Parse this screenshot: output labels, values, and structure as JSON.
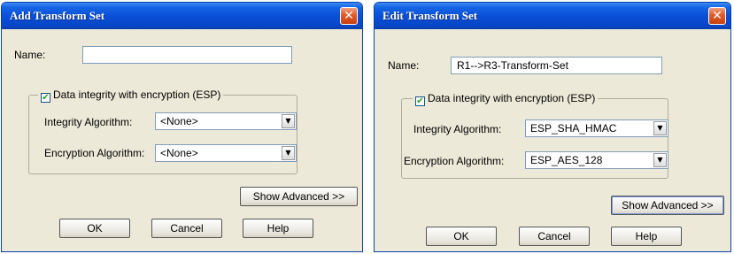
{
  "dialogs": [
    {
      "title": "Add Transform Set",
      "close_glyph": "✕",
      "name_label": "Name:",
      "name_value": "",
      "group_label": "Data integrity with encryption (ESP)",
      "group_checked": true,
      "check_glyph": "✔",
      "integrity_label": "Integrity Algorithm:",
      "integrity_value": "<None>",
      "encryption_label": "Encryption Algorithm:",
      "encryption_value": "<None>",
      "dropdown_glyph": "▼",
      "show_advanced_label": "Show Advanced >>",
      "ok_label": "OK",
      "cancel_label": "Cancel",
      "help_label": "Help"
    },
    {
      "title": "Edit Transform Set",
      "close_glyph": "✕",
      "name_label": "Name:",
      "name_value": "R1-->R3-Transform-Set",
      "group_label": "Data integrity with encryption (ESP)",
      "group_checked": true,
      "check_glyph": "✔",
      "integrity_label": "Integrity Algorithm:",
      "integrity_value": "ESP_SHA_HMAC",
      "encryption_label": "Encryption Algorithm:",
      "encryption_value": "ESP_AES_128",
      "dropdown_glyph": "▼",
      "show_advanced_label": "Show Advanced >>",
      "ok_label": "OK",
      "cancel_label": "Cancel",
      "help_label": "Help"
    }
  ],
  "colors": {
    "title_bar": "#0a4fd8",
    "close_button": "#e05a28",
    "dialog_face": "#ece9d8",
    "field_border": "#7f9db9"
  }
}
